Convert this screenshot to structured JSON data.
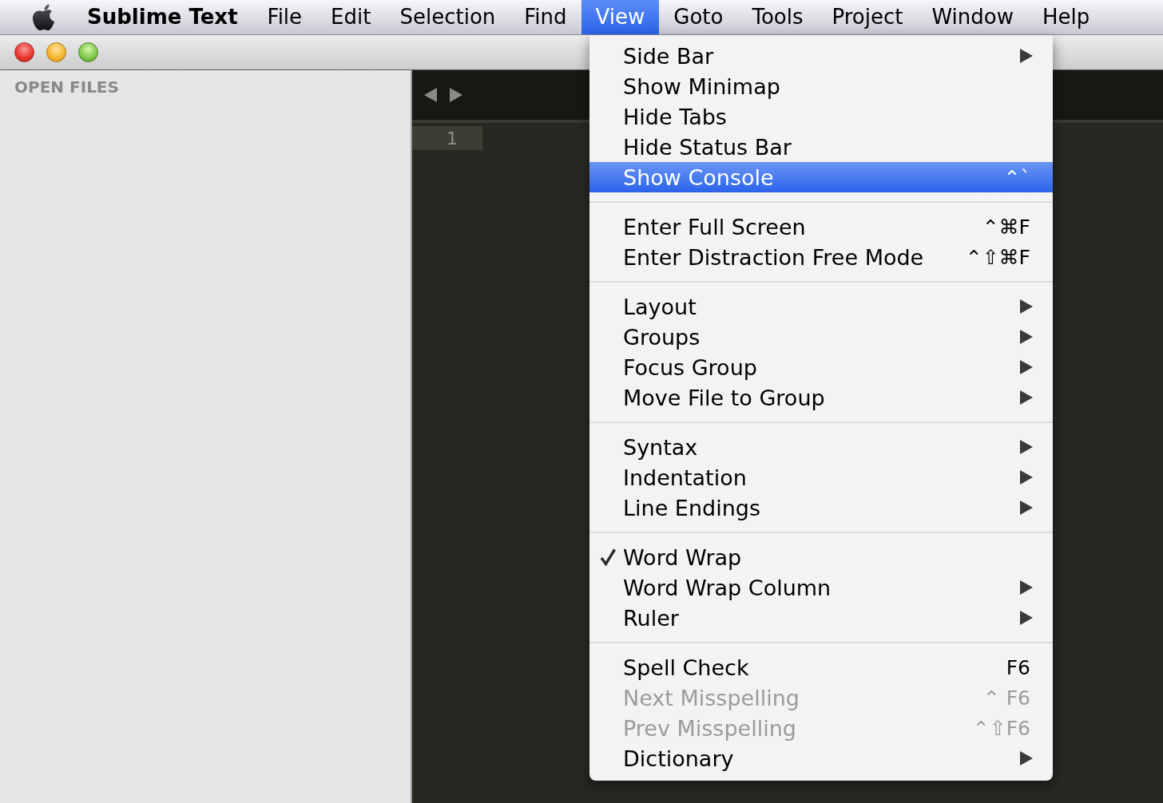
{
  "menu_bar": {
    "app_name": "Sublime Text",
    "menus": [
      {
        "label": "File",
        "selected": false
      },
      {
        "label": "Edit",
        "selected": false
      },
      {
        "label": "Selection",
        "selected": false
      },
      {
        "label": "Find",
        "selected": false
      },
      {
        "label": "View",
        "selected": true
      },
      {
        "label": "Goto",
        "selected": false
      },
      {
        "label": "Tools",
        "selected": false
      },
      {
        "label": "Project",
        "selected": false
      },
      {
        "label": "Window",
        "selected": false
      },
      {
        "label": "Help",
        "selected": false
      }
    ]
  },
  "sidebar": {
    "heading": "OPEN FILES"
  },
  "editor": {
    "line_numbers": [
      "1"
    ]
  },
  "view_menu": {
    "groups": [
      {
        "items": [
          {
            "label": "Side Bar",
            "submenu": true,
            "checked": false,
            "disabled": false,
            "selected": false
          },
          {
            "label": "Show Minimap",
            "submenu": false,
            "checked": false,
            "disabled": false,
            "selected": false
          },
          {
            "label": "Hide Tabs",
            "submenu": false,
            "checked": false,
            "disabled": false,
            "selected": false
          },
          {
            "label": "Hide Status Bar",
            "submenu": false,
            "checked": false,
            "disabled": false,
            "selected": false
          },
          {
            "label": "Show Console",
            "shortcut": "⌃`",
            "submenu": false,
            "checked": false,
            "disabled": false,
            "selected": true
          }
        ]
      },
      {
        "items": [
          {
            "label": "Enter Full Screen",
            "shortcut": "⌃⌘F",
            "submenu": false,
            "checked": false,
            "disabled": false,
            "selected": false
          },
          {
            "label": "Enter Distraction Free Mode",
            "shortcut": "⌃⇧⌘F",
            "submenu": false,
            "checked": false,
            "disabled": false,
            "selected": false
          }
        ]
      },
      {
        "items": [
          {
            "label": "Layout",
            "submenu": true,
            "checked": false,
            "disabled": false,
            "selected": false
          },
          {
            "label": "Groups",
            "submenu": true,
            "checked": false,
            "disabled": false,
            "selected": false
          },
          {
            "label": "Focus Group",
            "submenu": true,
            "checked": false,
            "disabled": false,
            "selected": false
          },
          {
            "label": "Move File to Group",
            "submenu": true,
            "checked": false,
            "disabled": false,
            "selected": false
          }
        ]
      },
      {
        "items": [
          {
            "label": "Syntax",
            "submenu": true,
            "checked": false,
            "disabled": false,
            "selected": false
          },
          {
            "label": "Indentation",
            "submenu": true,
            "checked": false,
            "disabled": false,
            "selected": false
          },
          {
            "label": "Line Endings",
            "submenu": true,
            "checked": false,
            "disabled": false,
            "selected": false
          }
        ]
      },
      {
        "items": [
          {
            "label": "Word Wrap",
            "submenu": false,
            "checked": true,
            "disabled": false,
            "selected": false
          },
          {
            "label": "Word Wrap Column",
            "submenu": true,
            "checked": false,
            "disabled": false,
            "selected": false
          },
          {
            "label": "Ruler",
            "submenu": true,
            "checked": false,
            "disabled": false,
            "selected": false
          }
        ]
      },
      {
        "items": [
          {
            "label": "Spell Check",
            "shortcut": "F6",
            "submenu": false,
            "checked": false,
            "disabled": false,
            "selected": false
          },
          {
            "label": "Next Misspelling",
            "shortcut": "⌃ F6",
            "submenu": false,
            "checked": false,
            "disabled": true,
            "selected": false
          },
          {
            "label": "Prev Misspelling",
            "shortcut": "⌃⇧F6",
            "submenu": false,
            "checked": false,
            "disabled": true,
            "selected": false
          },
          {
            "label": "Dictionary",
            "submenu": true,
            "checked": false,
            "disabled": false,
            "selected": false
          }
        ]
      }
    ]
  }
}
